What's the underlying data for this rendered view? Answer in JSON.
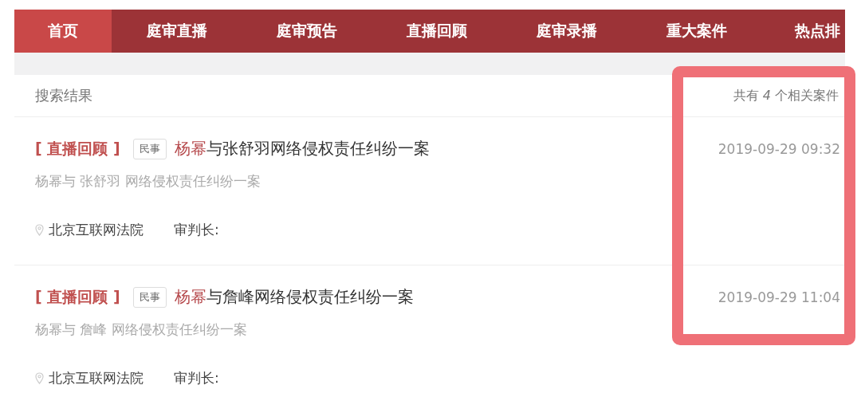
{
  "nav": {
    "tabs": [
      {
        "label": "首页",
        "selected": true
      },
      {
        "label": "庭审直播",
        "selected": false
      },
      {
        "label": "庭审预告",
        "selected": false
      },
      {
        "label": "直播回顾",
        "selected": false
      },
      {
        "label": "庭审录播",
        "selected": false
      },
      {
        "label": "重大案件",
        "selected": false
      },
      {
        "label": "热点排",
        "selected": false
      }
    ]
  },
  "results": {
    "heading": "搜索结果",
    "count_text": "共有 *4* 个相关案件",
    "cases": [
      {
        "status": "[ 直播回顾 ]",
        "category": "民事",
        "title_highlight": "杨幂",
        "title_rest": "与张舒羽网络侵权责任纠纷一案",
        "subtitle": "杨幂与 张舒羽 网络侵权责任纠纷一案",
        "court": "北京互联网法院",
        "judge_label": "审判长:",
        "time": "2019-09-29 09:32"
      },
      {
        "status": "[ 直播回顾 ]",
        "category": "民事",
        "title_highlight": "杨幂",
        "title_rest": "与詹峰网络侵权责任纠纷一案",
        "subtitle": "杨幂与 詹峰 网络侵权责任纠纷一案",
        "court": "北京互联网法院",
        "judge_label": "审判长:",
        "time": "2019-09-29 11:04"
      }
    ]
  }
}
